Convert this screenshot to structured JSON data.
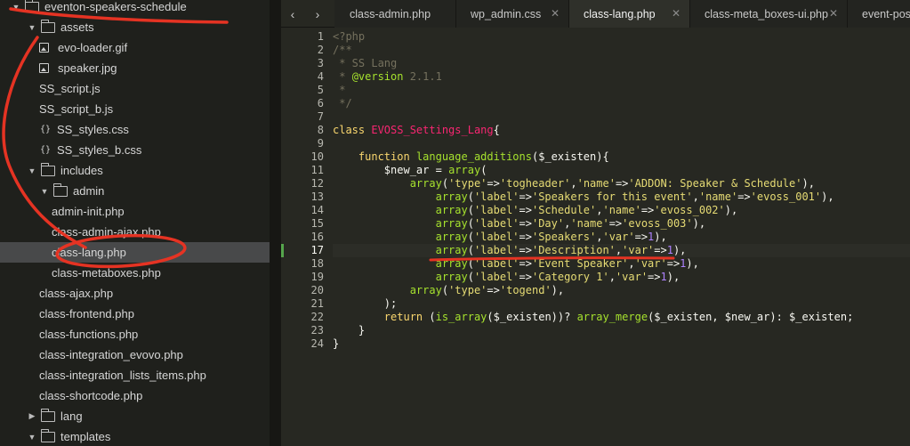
{
  "sidebar": {
    "items": [
      {
        "label": "eventon-speakers-schedule",
        "type": "folder",
        "state": "open"
      },
      {
        "label": "assets",
        "type": "folder",
        "state": "open"
      },
      {
        "label": "evo-loader.gif",
        "type": "image"
      },
      {
        "label": "speaker.jpg",
        "type": "image"
      },
      {
        "label": "SS_script.js",
        "type": "file"
      },
      {
        "label": "SS_script_b.js",
        "type": "file"
      },
      {
        "label": "SS_styles.css",
        "type": "css"
      },
      {
        "label": "SS_styles_b.css",
        "type": "css"
      },
      {
        "label": "includes",
        "type": "folder",
        "state": "open"
      },
      {
        "label": "admin",
        "type": "folder",
        "state": "open"
      },
      {
        "label": "admin-init.php",
        "type": "file"
      },
      {
        "label": "class-admin-ajax.php",
        "type": "file"
      },
      {
        "label": "class-lang.php",
        "type": "file",
        "selected": true
      },
      {
        "label": "class-metaboxes.php",
        "type": "file"
      },
      {
        "label": "class-ajax.php",
        "type": "file"
      },
      {
        "label": "class-frontend.php",
        "type": "file"
      },
      {
        "label": "class-functions.php",
        "type": "file"
      },
      {
        "label": "class-integration_evovo.php",
        "type": "file"
      },
      {
        "label": "class-integration_lists_items.php",
        "type": "file"
      },
      {
        "label": "class-shortcode.php",
        "type": "file"
      },
      {
        "label": "lang",
        "type": "folder",
        "state": "closed"
      },
      {
        "label": "templates",
        "type": "folder",
        "state": "open"
      }
    ]
  },
  "tabs": [
    {
      "label": "class-admin.php"
    },
    {
      "label": "wp_admin.css",
      "close": "✕"
    },
    {
      "label": "class-lang.php",
      "close": "✕",
      "active": true
    },
    {
      "label": "class-meta_boxes-ui.php",
      "close": "✕"
    },
    {
      "label": "event-post"
    }
  ],
  "nav": {
    "back": "‹",
    "forward": "›"
  },
  "editor": {
    "current_line": 17,
    "lines": [
      {
        "n": "1",
        "t": [
          [
            "c-comment",
            "<?php"
          ]
        ]
      },
      {
        "n": "2",
        "t": [
          [
            "c-comment",
            "/**"
          ]
        ]
      },
      {
        "n": "3",
        "t": [
          [
            "c-comment",
            " * SS Lang"
          ]
        ]
      },
      {
        "n": "4",
        "t": [
          [
            "c-comment",
            " * "
          ],
          [
            "c-doc",
            "@version"
          ],
          [
            "c-comment",
            " 2.1.1"
          ]
        ]
      },
      {
        "n": "5",
        "t": [
          [
            "c-comment",
            " *"
          ]
        ]
      },
      {
        "n": "6",
        "t": [
          [
            "c-comment",
            " */"
          ]
        ]
      },
      {
        "n": "7",
        "t": []
      },
      {
        "n": "8",
        "t": [
          [
            "c-kw",
            "class "
          ],
          [
            "c-cls",
            "EVOSS_Settings_Lang"
          ],
          [
            "c-op",
            "{"
          ]
        ]
      },
      {
        "n": "9",
        "t": []
      },
      {
        "n": "10",
        "t": [
          [
            "c-op",
            "    "
          ],
          [
            "c-kw",
            "function "
          ],
          [
            "c-fn",
            "language_additions"
          ],
          [
            "c-op",
            "("
          ],
          [
            "c-var",
            "$_existen"
          ],
          [
            "c-op",
            "){"
          ]
        ]
      },
      {
        "n": "11",
        "t": [
          [
            "c-op",
            "        "
          ],
          [
            "c-var",
            "$new_ar"
          ],
          [
            "c-op",
            " = "
          ],
          [
            "c-fn",
            "array"
          ],
          [
            "c-op",
            "("
          ]
        ]
      },
      {
        "n": "12",
        "t": [
          [
            "c-op",
            "            "
          ],
          [
            "c-fn",
            "array"
          ],
          [
            "c-op",
            "("
          ],
          [
            "c-str",
            "'type'"
          ],
          [
            "c-op",
            "=>"
          ],
          [
            "c-str",
            "'togheader'"
          ],
          [
            "c-op",
            ","
          ],
          [
            "c-str",
            "'name'"
          ],
          [
            "c-op",
            "=>"
          ],
          [
            "c-str",
            "'ADDON: Speaker & Schedule'"
          ],
          [
            "c-op",
            "),"
          ]
        ]
      },
      {
        "n": "13",
        "t": [
          [
            "c-op",
            "                "
          ],
          [
            "c-fn",
            "array"
          ],
          [
            "c-op",
            "("
          ],
          [
            "c-str",
            "'label'"
          ],
          [
            "c-op",
            "=>"
          ],
          [
            "c-str",
            "'Speakers for this event'"
          ],
          [
            "c-op",
            ","
          ],
          [
            "c-str",
            "'name'"
          ],
          [
            "c-op",
            "=>"
          ],
          [
            "c-str",
            "'evoss_001'"
          ],
          [
            "c-op",
            "),"
          ]
        ]
      },
      {
        "n": "14",
        "t": [
          [
            "c-op",
            "                "
          ],
          [
            "c-fn",
            "array"
          ],
          [
            "c-op",
            "("
          ],
          [
            "c-str",
            "'label'"
          ],
          [
            "c-op",
            "=>"
          ],
          [
            "c-str",
            "'Schedule'"
          ],
          [
            "c-op",
            ","
          ],
          [
            "c-str",
            "'name'"
          ],
          [
            "c-op",
            "=>"
          ],
          [
            "c-str",
            "'evoss_002'"
          ],
          [
            "c-op",
            "),"
          ]
        ]
      },
      {
        "n": "15",
        "t": [
          [
            "c-op",
            "                "
          ],
          [
            "c-fn",
            "array"
          ],
          [
            "c-op",
            "("
          ],
          [
            "c-str",
            "'label'"
          ],
          [
            "c-op",
            "=>"
          ],
          [
            "c-str",
            "'Day'"
          ],
          [
            "c-op",
            ","
          ],
          [
            "c-str",
            "'name'"
          ],
          [
            "c-op",
            "=>"
          ],
          [
            "c-str",
            "'evoss_003'"
          ],
          [
            "c-op",
            "),"
          ]
        ]
      },
      {
        "n": "16",
        "t": [
          [
            "c-op",
            "                "
          ],
          [
            "c-fn",
            "array"
          ],
          [
            "c-op",
            "("
          ],
          [
            "c-str",
            "'label'"
          ],
          [
            "c-op",
            "=>"
          ],
          [
            "c-str",
            "'Speakers'"
          ],
          [
            "c-op",
            ","
          ],
          [
            "c-str",
            "'var'"
          ],
          [
            "c-op",
            "=>"
          ],
          [
            "c-num",
            "1"
          ],
          [
            "c-op",
            "),"
          ]
        ]
      },
      {
        "n": "17",
        "t": [
          [
            "c-op",
            "                "
          ],
          [
            "c-fn",
            "array"
          ],
          [
            "c-op",
            "("
          ],
          [
            "c-str",
            "'label'"
          ],
          [
            "c-op",
            "=>"
          ],
          [
            "c-str",
            "'Description'"
          ],
          [
            "c-op",
            ","
          ],
          [
            "c-str",
            "'var'"
          ],
          [
            "c-op",
            "=>"
          ],
          [
            "c-num",
            "1"
          ],
          [
            "c-op",
            "),"
          ]
        ]
      },
      {
        "n": "18",
        "t": [
          [
            "c-op",
            "                "
          ],
          [
            "c-fn",
            "array"
          ],
          [
            "c-op",
            "("
          ],
          [
            "c-str",
            "'label'"
          ],
          [
            "c-op",
            "=>"
          ],
          [
            "c-str",
            "'Event Speaker'"
          ],
          [
            "c-op",
            ","
          ],
          [
            "c-str",
            "'var'"
          ],
          [
            "c-op",
            "=>"
          ],
          [
            "c-num",
            "1"
          ],
          [
            "c-op",
            "),"
          ]
        ]
      },
      {
        "n": "19",
        "t": [
          [
            "c-op",
            "                "
          ],
          [
            "c-fn",
            "array"
          ],
          [
            "c-op",
            "("
          ],
          [
            "c-str",
            "'label'"
          ],
          [
            "c-op",
            "=>"
          ],
          [
            "c-str",
            "'Category 1'"
          ],
          [
            "c-op",
            ","
          ],
          [
            "c-str",
            "'var'"
          ],
          [
            "c-op",
            "=>"
          ],
          [
            "c-num",
            "1"
          ],
          [
            "c-op",
            "),"
          ]
        ]
      },
      {
        "n": "20",
        "t": [
          [
            "c-op",
            "            "
          ],
          [
            "c-fn",
            "array"
          ],
          [
            "c-op",
            "("
          ],
          [
            "c-str",
            "'type'"
          ],
          [
            "c-op",
            "=>"
          ],
          [
            "c-str",
            "'togend'"
          ],
          [
            "c-op",
            "),"
          ]
        ]
      },
      {
        "n": "21",
        "t": [
          [
            "c-op",
            "        );"
          ]
        ]
      },
      {
        "n": "22",
        "t": [
          [
            "c-op",
            "        "
          ],
          [
            "c-kw",
            "return "
          ],
          [
            "c-op",
            "("
          ],
          [
            "c-builtin",
            "is_array"
          ],
          [
            "c-op",
            "("
          ],
          [
            "c-var",
            "$_existen"
          ],
          [
            "c-op",
            "))? "
          ],
          [
            "c-builtin",
            "array_merge"
          ],
          [
            "c-op",
            "("
          ],
          [
            "c-var",
            "$_existen"
          ],
          [
            "c-op",
            ", "
          ],
          [
            "c-var",
            "$new_ar"
          ],
          [
            "c-op",
            "): "
          ],
          [
            "c-var",
            "$_existen"
          ],
          [
            "c-op",
            ";"
          ]
        ]
      },
      {
        "n": "23",
        "t": [
          [
            "c-op",
            "    }"
          ]
        ]
      },
      {
        "n": "24",
        "t": [
          [
            "c-op",
            "}"
          ]
        ]
      }
    ]
  },
  "colors": {
    "annotation": "#e53323",
    "selection": "#48494a",
    "cursor_marker": "#55a54c"
  }
}
